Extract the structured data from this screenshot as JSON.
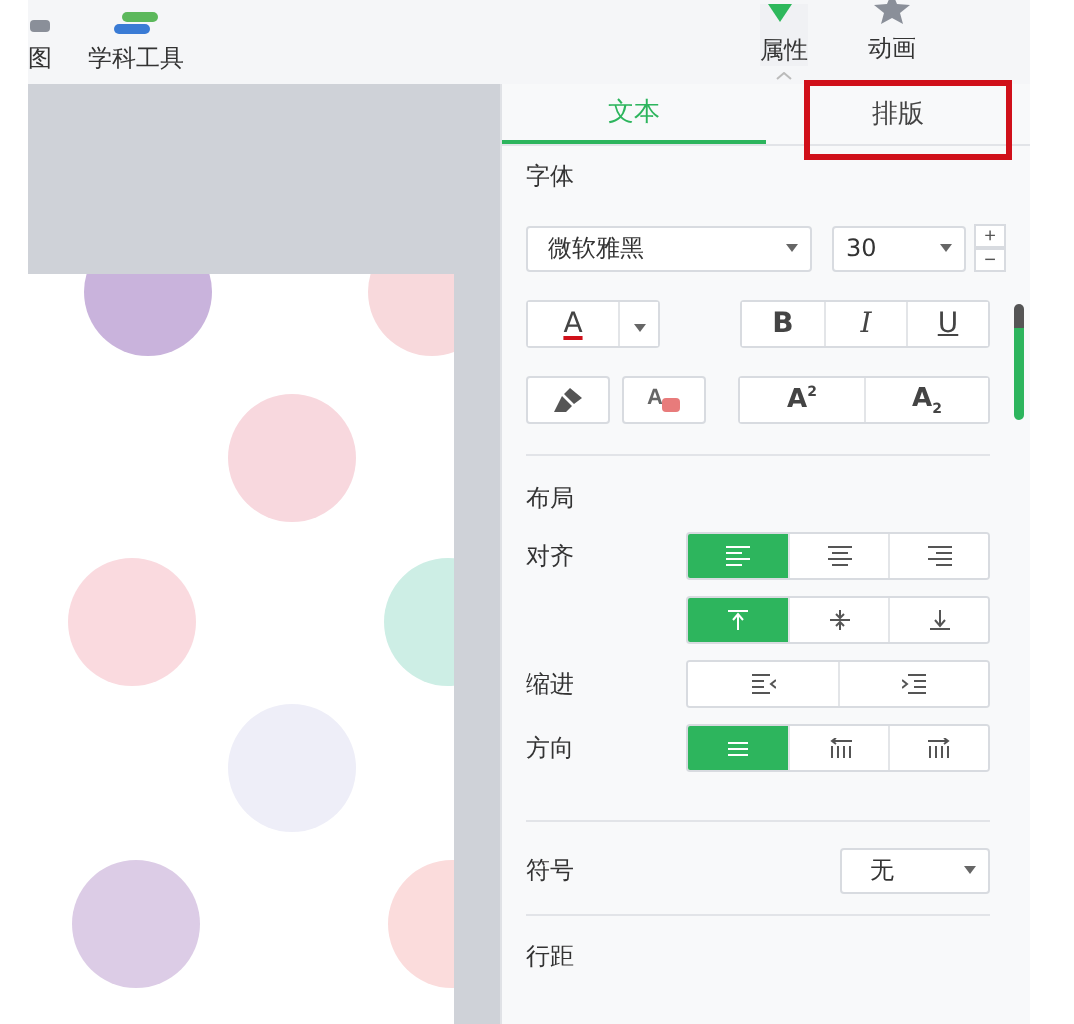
{
  "toolbar": {
    "items": [
      {
        "label": "图",
        "kind": "mindmap",
        "selected": false
      },
      {
        "label": "学科工具",
        "kind": "books",
        "selected": false
      }
    ],
    "right_items": [
      {
        "label": "属性",
        "kind": "properties",
        "selected": true
      },
      {
        "label": "动画",
        "kind": "star",
        "selected": false
      }
    ]
  },
  "panel": {
    "tabs": [
      {
        "label": "文本",
        "selected": true,
        "highlighted": false
      },
      {
        "label": "排版",
        "selected": false,
        "highlighted": true
      }
    ],
    "font_section": {
      "title": "字体",
      "font": "微软雅黑",
      "size": "30",
      "increase": "+",
      "decrease": "−",
      "color_button": "A",
      "style_buttons": [
        {
          "label": "B",
          "kind": "bold"
        },
        {
          "label": "I",
          "kind": "italic"
        },
        {
          "label": "U",
          "kind": "underline"
        }
      ],
      "script_buttons": [
        {
          "label": "A",
          "mark": "2",
          "kind": "superscript"
        },
        {
          "label": "A",
          "mark": "2",
          "kind": "subscript"
        }
      ],
      "clear_format_label": "A"
    },
    "layout_section": {
      "title": "布局",
      "align_label": "对齐",
      "horizontal_align": [
        {
          "kind": "align-left",
          "selected": true
        },
        {
          "kind": "align-center",
          "selected": false
        },
        {
          "kind": "align-right",
          "selected": false
        }
      ],
      "vertical_align": [
        {
          "kind": "align-top",
          "selected": true
        },
        {
          "kind": "align-middle",
          "selected": false
        },
        {
          "kind": "align-bottom",
          "selected": false
        }
      ],
      "indent_label": "缩进",
      "indent": [
        {
          "kind": "indent-decrease",
          "selected": false
        },
        {
          "kind": "indent-increase",
          "selected": false
        }
      ],
      "direction_label": "方向",
      "direction": [
        {
          "kind": "horizontal",
          "selected": true
        },
        {
          "kind": "vertical-rtl",
          "selected": false
        },
        {
          "kind": "vertical-ltr",
          "selected": false
        }
      ]
    },
    "symbol_label": "符号",
    "symbol_value": "无",
    "line_spacing_label": "行距"
  }
}
